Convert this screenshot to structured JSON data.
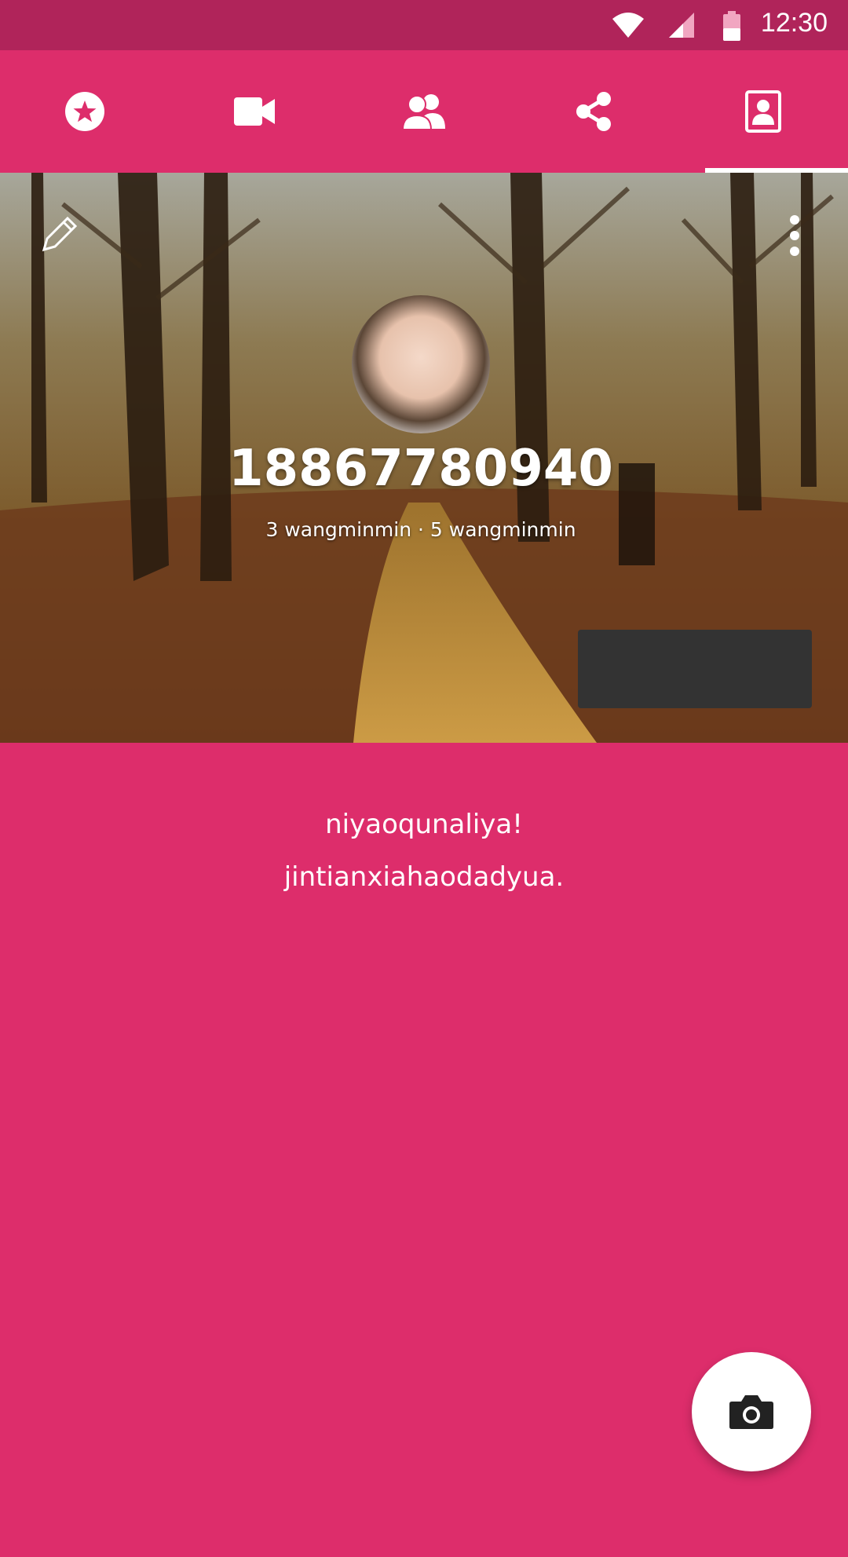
{
  "status_bar": {
    "time": "12:30",
    "icons": [
      "wifi-icon",
      "cell-signal-icon",
      "battery-icon"
    ]
  },
  "tabs": [
    {
      "icon": "star-circle-icon",
      "selected": false
    },
    {
      "icon": "video-camera-icon",
      "selected": false
    },
    {
      "icon": "group-icon",
      "selected": false
    },
    {
      "icon": "share-icon",
      "selected": false
    },
    {
      "icon": "contact-card-icon",
      "selected": true
    }
  ],
  "header": {
    "edit_icon": "pencil-icon",
    "menu_icon": "more-vertical-icon",
    "phone_number": "18867780940",
    "subtitle": "3 wangminmin · 5 wangminmin"
  },
  "content": {
    "line1": "niyaoqunaliya!",
    "line2": "jintianxiahaodadyua."
  },
  "fab": {
    "icon": "camera-icon"
  },
  "colors": {
    "primary": "#dd2d6b",
    "status_bar": "#b0245a",
    "fab": "#ffffff"
  }
}
